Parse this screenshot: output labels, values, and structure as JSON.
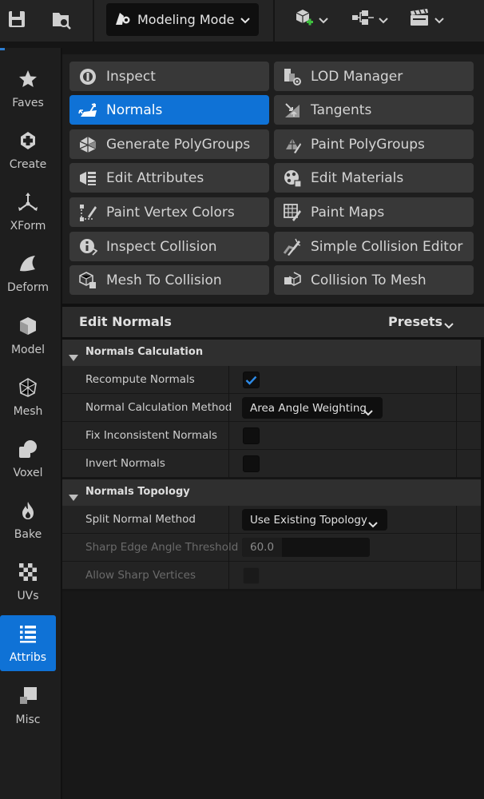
{
  "toolbar": {
    "save_icon": "save-icon",
    "browse_icon": "content-browser-icon",
    "mode_label": "Modeling Mode",
    "mode_icon": "modeling-mode-icon",
    "add_icon": "add-actor-icon",
    "blueprint_icon": "blueprint-icon",
    "cinematics_icon": "cinematics-icon"
  },
  "rail": {
    "items": [
      {
        "label": "Faves",
        "icon": "star-icon"
      },
      {
        "label": "Create",
        "icon": "create-icon"
      },
      {
        "label": "XForm",
        "icon": "transform-icon"
      },
      {
        "label": "Deform",
        "icon": "deform-icon"
      },
      {
        "label": "Model",
        "icon": "model-icon"
      },
      {
        "label": "Mesh",
        "icon": "mesh-icon"
      },
      {
        "label": "Voxel",
        "icon": "voxel-icon"
      },
      {
        "label": "Bake",
        "icon": "bake-flame-icon"
      },
      {
        "label": "UVs",
        "icon": "uvs-checker-icon"
      },
      {
        "label": "Attribs",
        "icon": "attributes-list-icon"
      },
      {
        "label": "Misc",
        "icon": "misc-icon"
      }
    ],
    "active": "Attribs"
  },
  "tools": {
    "items": [
      {
        "label": "Inspect",
        "icon": "inspect-icon"
      },
      {
        "label": "LOD Manager",
        "icon": "lod-manager-icon"
      },
      {
        "label": "Normals",
        "icon": "normals-icon"
      },
      {
        "label": "Tangents",
        "icon": "tangents-icon"
      },
      {
        "label": "Generate PolyGroups",
        "icon": "generate-polygroups-icon"
      },
      {
        "label": "Paint PolyGroups",
        "icon": "paint-polygroups-icon"
      },
      {
        "label": "Edit Attributes",
        "icon": "edit-attributes-icon"
      },
      {
        "label": "Edit Materials",
        "icon": "edit-materials-icon"
      },
      {
        "label": "Paint Vertex Colors",
        "icon": "paint-vertex-colors-icon"
      },
      {
        "label": "Paint Maps",
        "icon": "paint-maps-icon"
      },
      {
        "label": "Inspect Collision",
        "icon": "inspect-collision-icon"
      },
      {
        "label": "Simple Collision Editor",
        "icon": "simple-collision-editor-icon"
      },
      {
        "label": "Mesh To Collision",
        "icon": "mesh-to-collision-icon"
      },
      {
        "label": "Collision To Mesh",
        "icon": "collision-to-mesh-icon"
      }
    ],
    "active": "Normals"
  },
  "panel": {
    "title": "Edit Normals",
    "presets_label": "Presets"
  },
  "sections": [
    {
      "title": "Normals Calculation",
      "rows": [
        {
          "label": "Recompute Normals",
          "type": "checkbox",
          "checked": true
        },
        {
          "label": "Normal Calculation Method",
          "type": "combo",
          "value": "Area Angle Weighting"
        },
        {
          "label": "Fix Inconsistent Normals",
          "type": "checkbox",
          "checked": false
        },
        {
          "label": "Invert Normals",
          "type": "checkbox",
          "checked": false
        }
      ]
    },
    {
      "title": "Normals Topology",
      "rows": [
        {
          "label": "Split Normal Method",
          "type": "combo",
          "value": "Use Existing Topology"
        },
        {
          "label": "Sharp Edge Angle Threshold",
          "type": "number",
          "value": "60.0",
          "disabled": true
        },
        {
          "label": "Allow Sharp Vertices",
          "type": "checkbox",
          "checked": false,
          "disabled": true
        }
      ]
    }
  ],
  "colors": {
    "accent": "#0f72d6",
    "panel": "#232323",
    "background": "#151515"
  }
}
